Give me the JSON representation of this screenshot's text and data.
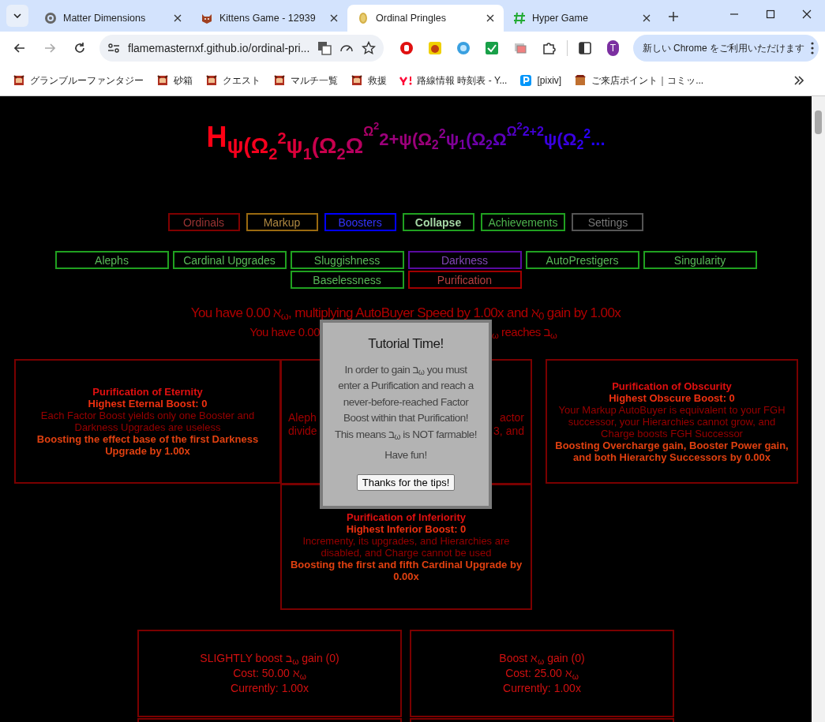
{
  "browser": {
    "tabs": [
      {
        "title": "Matter Dimensions",
        "selected": false
      },
      {
        "title": "Kittens Game - 12939",
        "selected": false
      },
      {
        "title": "Ordinal Pringles",
        "selected": true
      },
      {
        "title": "Hyper Game",
        "selected": false
      }
    ],
    "url": "flamemasternxf.github.io/ordinal-pri...",
    "profile_initial": "T",
    "update_button": "新しい Chrome をご利用いただけます",
    "bookmarks": [
      {
        "label": "グランブルーファンタジー"
      },
      {
        "label": "砂箱"
      },
      {
        "label": "クエスト"
      },
      {
        "label": "マルチ一覧"
      },
      {
        "label": "救援"
      },
      {
        "label": "路線情報 時刻表 - Y..."
      },
      {
        "label": "[pixiv]"
      },
      {
        "label": "ご来店ポイント｜コミッ..."
      }
    ]
  },
  "title_segments": [
    {
      "text": "H",
      "kind": "h"
    },
    {
      "text": "ψ(Ω",
      "kind": "a"
    },
    {
      "text": "2",
      "kind": "a_sub"
    },
    {
      "text": "2",
      "kind": "a_sup"
    },
    {
      "text": "ψ",
      "kind": "a"
    },
    {
      "text": "1",
      "kind": "a_sub"
    },
    {
      "text": "(Ω",
      "kind": "a"
    },
    {
      "text": "2",
      "kind": "a_sub"
    },
    {
      "text": "Ω",
      "kind": "a"
    },
    {
      "text": "Ω",
      "kind": "c"
    },
    {
      "text": "2",
      "kind": "c_sup"
    },
    {
      "text": "2+ψ(Ω",
      "kind": "b"
    },
    {
      "text": "2",
      "kind": "b_sub"
    },
    {
      "text": "2",
      "kind": "b_sup"
    },
    {
      "text": "ψ",
      "kind": "b"
    },
    {
      "text": "1",
      "kind": "b_sub"
    },
    {
      "text": "(Ω",
      "kind": "b"
    },
    {
      "text": "2",
      "kind": "b_sub"
    },
    {
      "text": "Ω",
      "kind": "b"
    },
    {
      "text": "Ω",
      "kind": "c"
    },
    {
      "text": "2",
      "kind": "c_sup"
    },
    {
      "text": "2+2",
      "kind": "c"
    },
    {
      "text": "ψ(Ω",
      "kind": "b"
    },
    {
      "text": "2",
      "kind": "b_sub"
    },
    {
      "text": "2",
      "kind": "b_sup"
    },
    {
      "text": "...",
      "kind": "b"
    }
  ],
  "main_tabs": [
    {
      "label": "Ordinals",
      "color": "#800000",
      "selected": false
    },
    {
      "label": "Markup",
      "color": "#9a6a10",
      "selected": false
    },
    {
      "label": "Boosters",
      "color": "#0000ff",
      "selected": false
    },
    {
      "label": "Collapse",
      "color": "#20a020",
      "selected": true
    },
    {
      "label": "Achievements",
      "color": "#20a020",
      "selected": false
    },
    {
      "label": "Settings",
      "color": "#555555",
      "selected": false
    }
  ],
  "sub_tabs": [
    {
      "label": "Alephs",
      "color": "#20a020"
    },
    {
      "label": "Cardinal Upgrades",
      "color": "#20a020"
    },
    {
      "label": "Sluggishness",
      "color": "#20a020"
    },
    {
      "label": "Darkness",
      "color": "#5a0aa0"
    },
    {
      "label": "AutoPrestigers",
      "color": "#20a020"
    },
    {
      "label": "Singularity",
      "color": "#20a020"
    },
    {
      "label": "Baselessness",
      "color": "#20a020"
    },
    {
      "label": "Purification",
      "color": "#a00000"
    }
  ],
  "info_line": "You have 0.00 ℵ$_{ω}$, multiplying AutoBuyer Speed by 1.00x and ℵ$_{0}$ gain by 1.00x",
  "info_line_2_start": "You have 0.00",
  "info_line_2_end": "$_{ω}$ reaches ב$_{ω}$",
  "purifications": [
    {
      "title": "Purification of Eternity",
      "best": "Highest Eternal Boost: 0",
      "effect": "Each Factor Boost yields only one Booster and Darkness Upgrades are useless",
      "reward": "Boosting the effect base of the first Darkness Upgrade by 1.00x"
    },
    {
      "fragments": [
        {
          "left": "Aleph",
          "right": "actor"
        },
        {
          "left": "divide",
          "right": "3, and"
        }
      ]
    },
    {
      "title": "Purification of Obscurity",
      "best": "Highest Obscure Boost: 0",
      "effect": "Your Markup AutoBuyer is equivalent to your FGH successor, your Hierarchies cannot grow, and Charge boosts FGH Successor",
      "reward": "Boosting Overcharge gain, Booster Power gain, and both Hierarchy Successors by 0.00x"
    },
    {
      "title": "Purification of Inferiority",
      "best": "Highest Inferior Boost: 0",
      "effect": "Incrementy, its upgrades, and Hierarchies are disabled, and Charge cannot be used",
      "reward": "Boosting the first and fifth Cardinal Upgrade by 0.00x"
    }
  ],
  "upgrades": [
    {
      "name": "SLIGHTLY boost ב$_{ω}$ gain (0)",
      "cost": "Cost: 50.00 ℵ$_{ω}$",
      "current": "Currently: 1.00x"
    },
    {
      "name": "Boost ℵ$_{ω}$ gain (0)",
      "cost": "Cost: 25.00 ℵ$_{ω}$",
      "current": "Currently: 1.00x"
    }
  ],
  "dialog": {
    "title": "Tutorial Time!",
    "lines": [
      "In order to gain ב$_{ω}$ you must",
      "enter a Purification and reach a",
      "never-before-reached Factor",
      "Boost within that Purification!",
      "This means ב$_{ω}$ is NOT farmable!"
    ],
    "closing": "Have fun!",
    "button": "Thanks for the tips!"
  }
}
